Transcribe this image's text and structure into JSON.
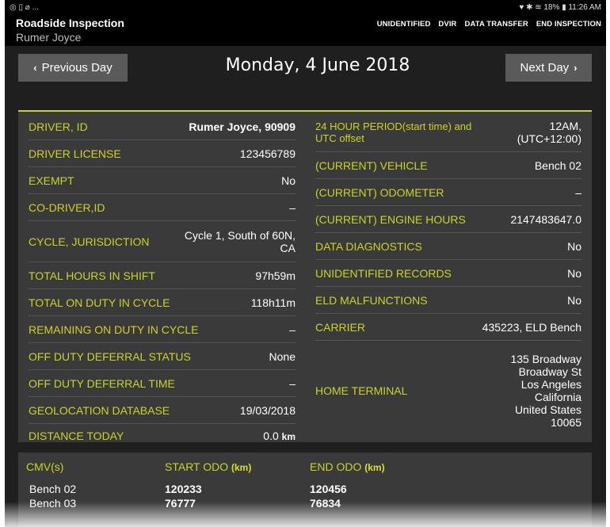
{
  "statusbar": {
    "left_icons": "◎ ▯ ⌀ ...",
    "right": "♥ ✱ ≋ 18% ▮ 11:26 AM"
  },
  "app": {
    "title": "Roadside Inspection",
    "subtitle": "Rumer Joyce"
  },
  "actions": [
    "UNIDENTIFIED",
    "DVIR",
    "DATA TRANSFER",
    "END INSPECTION"
  ],
  "daynav": {
    "prev_label": "Previous Day",
    "next_label": "Next Day",
    "date": "Monday, 4 June 2018"
  },
  "left_rows": [
    {
      "label": "DRIVER, ID",
      "value": "Rumer Joyce, 90909"
    },
    {
      "label": "DRIVER LICENSE",
      "value": "123456789"
    },
    {
      "label": "EXEMPT",
      "value": "No"
    },
    {
      "label": "CO-DRIVER,ID",
      "value": "–"
    },
    {
      "label": "CYCLE, JURISDICTION",
      "value": "Cycle 1, South of 60N, CA"
    },
    {
      "label": "TOTAL HOURS IN SHIFT",
      "value": "97h59m"
    },
    {
      "label": "TOTAL ON DUTY IN CYCLE",
      "value": "118h11m"
    },
    {
      "label": "REMAINING ON DUTY IN CYCLE",
      "value": "–"
    },
    {
      "label": "OFF DUTY DEFERRAL STATUS",
      "value": "None"
    },
    {
      "label": "OFF DUTY DEFERRAL TIME",
      "value": "–"
    },
    {
      "label": "GEOLOCATION DATABASE",
      "value": "19/03/2018"
    },
    {
      "label": "DISTANCE TODAY",
      "value": "0.0",
      "unit": "km"
    }
  ],
  "right_rows": [
    {
      "label": "24 HOUR PERIOD(start time) and UTC offset",
      "value": "12AM, (UTC+12:00)"
    },
    {
      "label": "(CURRENT) VEHICLE",
      "value": "Bench 02"
    },
    {
      "label": "(CURRENT) ODOMETER",
      "value": "–"
    },
    {
      "label": "(CURRENT) ENGINE HOURS",
      "value": "2147483647.0"
    },
    {
      "label": "DATA DIAGNOSTICS",
      "value": "No"
    },
    {
      "label": "UNIDENTIFIED RECORDS",
      "value": "No"
    },
    {
      "label": "ELD MALFUNCTIONS",
      "value": "No"
    },
    {
      "label": "CARRIER",
      "value": "435223, ELD Bench"
    },
    {
      "label": "HOME TERMINAL",
      "value": "135 Broadway\nBroadway St\nLos Angeles\nCalifornia\nUnited States\n10065"
    }
  ],
  "cmv": {
    "headers": {
      "cmv": "CMV(s)",
      "start": "START ODO",
      "end": "END ODO",
      "unit": "(km)"
    },
    "rows": [
      {
        "name": "Bench 02",
        "start": "120233",
        "end": "120456"
      },
      {
        "name": "Bench 03",
        "start": "76777",
        "end": "76834"
      }
    ]
  },
  "colors": {
    "accent": "#c8d42a",
    "panel": "#3a3a3a",
    "background": "#1f1f1f",
    "button": "#5a5a5a"
  }
}
